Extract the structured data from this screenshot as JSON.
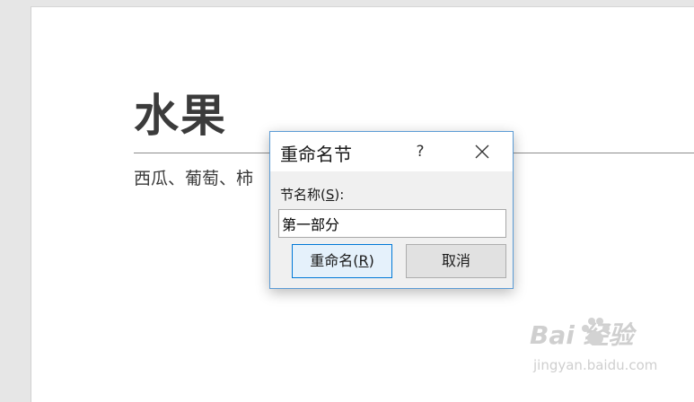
{
  "document": {
    "title": "水果",
    "body_text": "西瓜、葡萄、柿"
  },
  "dialog": {
    "title": "重命名节",
    "help_label": "?",
    "field_label_prefix": "节名称(",
    "field_label_accel": "S",
    "field_label_suffix": "):",
    "section_name_value": "第一部分",
    "rename_button_prefix": "重命名(",
    "rename_button_accel": "R",
    "rename_button_suffix": ")",
    "cancel_button_label": "取消"
  },
  "watermark": {
    "logo_text": "Bai  经验",
    "url": "jingyan.baidu.com"
  },
  "colors": {
    "dialog_border": "#5b9bd5",
    "primary_button_border": "#0078d7",
    "primary_button_bg": "#e5f1fb"
  }
}
